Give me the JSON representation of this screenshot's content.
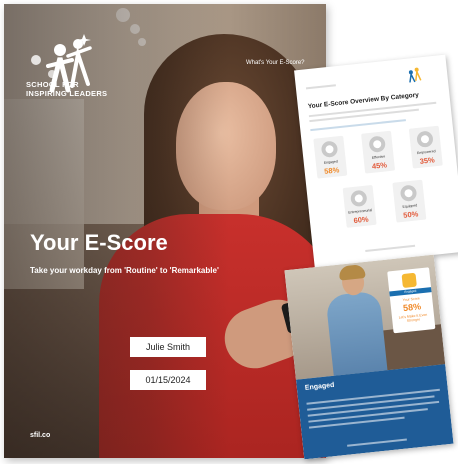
{
  "cover": {
    "logo_line1": "SCHOOL FOR",
    "logo_line2": "INSPIRING LEADERS",
    "title": "Your E-Score",
    "subtitle": "Take your workday from 'Routine' to 'Remarkable'",
    "name_value": "Julie Smith",
    "date_value": "01/15/2024",
    "url": "sfil.co"
  },
  "report_page_1": {
    "label": "What's Your E-Score?",
    "title": "Your E-Score Overview By Category",
    "categories": [
      {
        "name": "Engaged",
        "percent": "58%"
      },
      {
        "name": "Effective",
        "percent": "45%"
      },
      {
        "name": "Empowered",
        "percent": "35%"
      },
      {
        "name": "Entrepreneurial",
        "percent": "60%"
      },
      {
        "name": "Equipped",
        "percent": "50%"
      }
    ]
  },
  "report_page_2": {
    "badge_label": "Engaged",
    "score_caption": "Your Score",
    "score_percent": "58%",
    "score_sub": "Let's Make It Even Stronger",
    "heading": "Engaged"
  },
  "colors": {
    "shirt": "#c8302c",
    "score_orange": "#f08a2a",
    "score_red": "#e25a3a",
    "report_blue": "#1f5c97"
  }
}
